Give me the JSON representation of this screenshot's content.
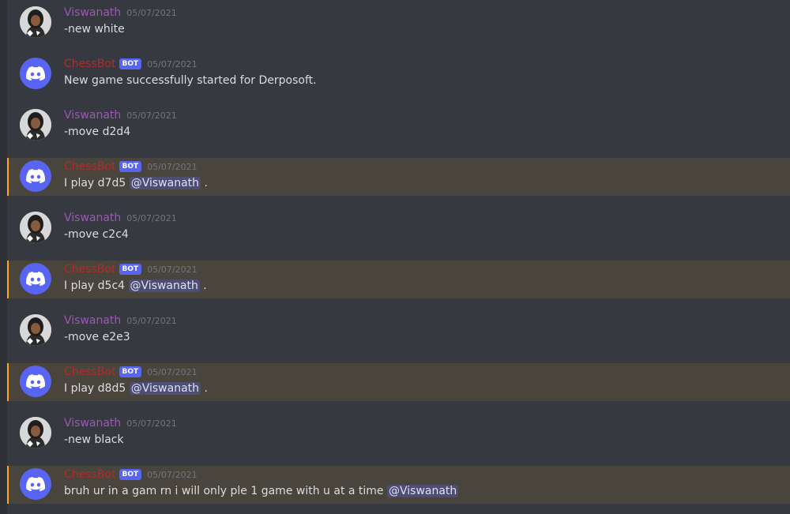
{
  "colors": {
    "background": "#36393f",
    "user_name": "#9b59b6",
    "bot_name": "#b22b2b",
    "bot_tag": "#5865f2",
    "mention_bg": "#49443c",
    "mention_bar": "#faa81a"
  },
  "messages": [
    {
      "author": "Viswanath",
      "timestamp": "05/07/2021",
      "text": "-new white"
    },
    {
      "author": "ChessBot",
      "tag": "BOT",
      "timestamp": "05/07/2021",
      "text": "New game successfully started for Derposoft."
    },
    {
      "author": "Viswanath",
      "timestamp": "05/07/2021",
      "text": "-move d2d4"
    },
    {
      "author": "ChessBot",
      "tag": "BOT",
      "timestamp": "05/07/2021",
      "text": "I play d7d5",
      "mention": "@Viswanath",
      "suffix": "."
    },
    {
      "author": "Viswanath",
      "timestamp": "05/07/2021",
      "text": "-move c2c4"
    },
    {
      "author": "ChessBot",
      "tag": "BOT",
      "timestamp": "05/07/2021",
      "text": "I play d5c4",
      "mention": "@Viswanath",
      "suffix": "."
    },
    {
      "author": "Viswanath",
      "timestamp": "05/07/2021",
      "text": "-move e2e3"
    },
    {
      "author": "ChessBot",
      "tag": "BOT",
      "timestamp": "05/07/2021",
      "text": "I play d8d5",
      "mention": "@Viswanath",
      "suffix": "."
    },
    {
      "author": "Viswanath",
      "timestamp": "05/07/2021",
      "text": "-new black"
    },
    {
      "author": "ChessBot",
      "tag": "BOT",
      "timestamp": "05/07/2021",
      "text": "bruh ur in a gam rn i will only ple 1 game with u at a time",
      "mention": "@Viswanath",
      "suffix": ""
    }
  ]
}
